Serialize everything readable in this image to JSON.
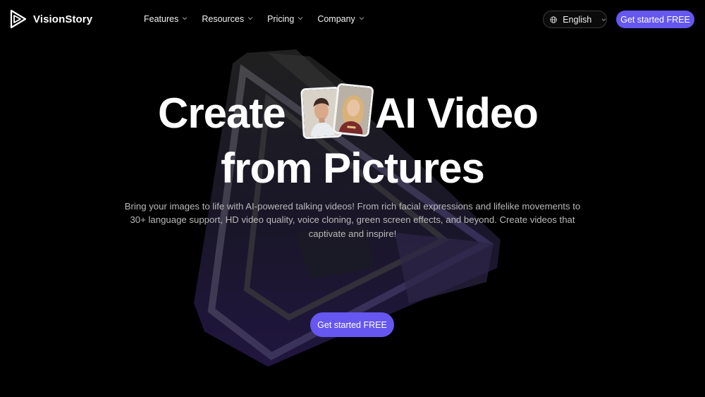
{
  "brand": {
    "name": "VisionStory",
    "logo_icon": "play-triangle-logo-icon"
  },
  "nav": {
    "items": [
      {
        "label": "Features",
        "icon": "chevron-down-icon"
      },
      {
        "label": "Resources",
        "icon": "chevron-down-icon"
      },
      {
        "label": "Pricing",
        "icon": "chevron-down-icon"
      },
      {
        "label": "Company",
        "icon": "chevron-down-icon"
      }
    ]
  },
  "language": {
    "label": "English",
    "icon": "globe-icon"
  },
  "header_cta": {
    "label": "Get started FREE"
  },
  "hero": {
    "title_part1": "Create",
    "title_part2": "AI Video",
    "title_line2": "from Pictures",
    "description": "Bring your images to life with AI-powered talking videos! From rich facial expressions and lifelike movements to 30+ language support, HD video quality, voice cloning, green screen effects, and beyond. Create videos that captivate and inspire!",
    "cta_label": "Get started FREE"
  },
  "colors": {
    "accent": "#6557f0",
    "background": "#000000",
    "text": "#ffffff",
    "muted_text": "#b9b9b9"
  }
}
